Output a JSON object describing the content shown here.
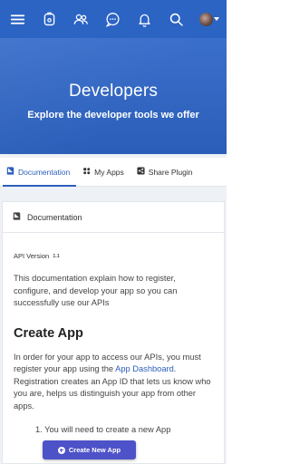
{
  "nav": {
    "icons": [
      "menu-icon",
      "tag-icon",
      "users-icon",
      "chat-icon",
      "bell-icon",
      "search-icon",
      "avatar"
    ],
    "accent": "#2c64c4"
  },
  "hero": {
    "title": "Developers",
    "subtitle": "Explore the developer tools we offer"
  },
  "tabs": [
    {
      "label": "Documentation",
      "icon": "book-icon",
      "active": true
    },
    {
      "label": "My Apps",
      "icon": "apps-icon",
      "active": false
    },
    {
      "label": "Share Plugin",
      "icon": "share-icon",
      "active": false
    }
  ],
  "card": {
    "header": "Documentation",
    "api_version_label": "API Version",
    "api_version_value": "1.1",
    "intro": "This documentation explain how to register, configure, and develop your app so you can successfully use our APIs",
    "section_title": "Create App",
    "para_part1": "In order for your app to access our APIs, you must register your app using the ",
    "para_link": "App Dashboard",
    "para_part2": ". Registration creates an App ID that lets us know who you are, helps us distinguish your app from other apps.",
    "list_item_1": "1. You will need to create a new App"
  },
  "create_button": {
    "label": "Create New App",
    "color": "#4d52c9"
  }
}
